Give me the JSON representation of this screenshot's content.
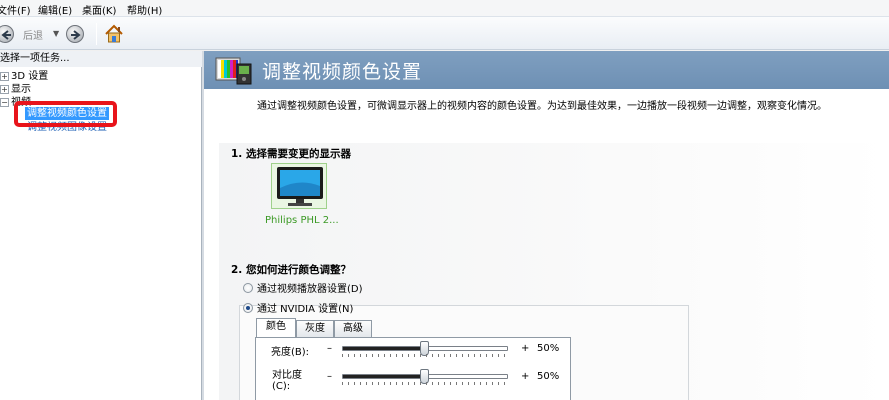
{
  "menu": {
    "file": "文件(F)",
    "edit": "编辑(E)",
    "desktop": "桌面(K)",
    "help": "帮助(H)"
  },
  "toolbar": {
    "back_label": "后退"
  },
  "left_pane": {
    "header": "选择一项任务...",
    "tree": {
      "item_3d": "3D 设置",
      "item_display": "显示",
      "item_video": "视频",
      "item_video_color": "调整视频颜色设置",
      "item_video_image": "调整视频图像设置"
    }
  },
  "right_pane": {
    "title": "调整视频颜色设置",
    "description": "通过调整视频颜色设置，可微调显示器上的视频内容的颜色设置。为达到最佳效果，一边播放一段视频一边调整，观察变化情况。",
    "section1": {
      "heading": "1. 选择需要变更的显示器",
      "display_name": "Philips PHL 2..."
    },
    "section2": {
      "heading": "2. 您如何进行颜色调整？",
      "option_player": "通过视频播放器设置(D)",
      "option_nvidia": "通过 NVIDIA 设置(N)",
      "selected_option": "option_nvidia"
    },
    "tabs": {
      "color": "颜色",
      "gamma": "灰度",
      "advanced": "高级",
      "active": "color"
    },
    "sliders": {
      "brightness": {
        "label": "亮度(B):",
        "minus": "–",
        "plus": "+",
        "value_text": "50%",
        "level": 0.5
      },
      "contrast": {
        "label_line1": "对比度",
        "label_line2": "(C):",
        "minus": "–",
        "plus": "+",
        "value_text": "50%",
        "level": 0.5
      }
    }
  },
  "colors": {
    "banner": "#7394b8",
    "selection": "#3399ff",
    "highlight_box": "#e8141b",
    "display_name": "#3c9a26"
  }
}
